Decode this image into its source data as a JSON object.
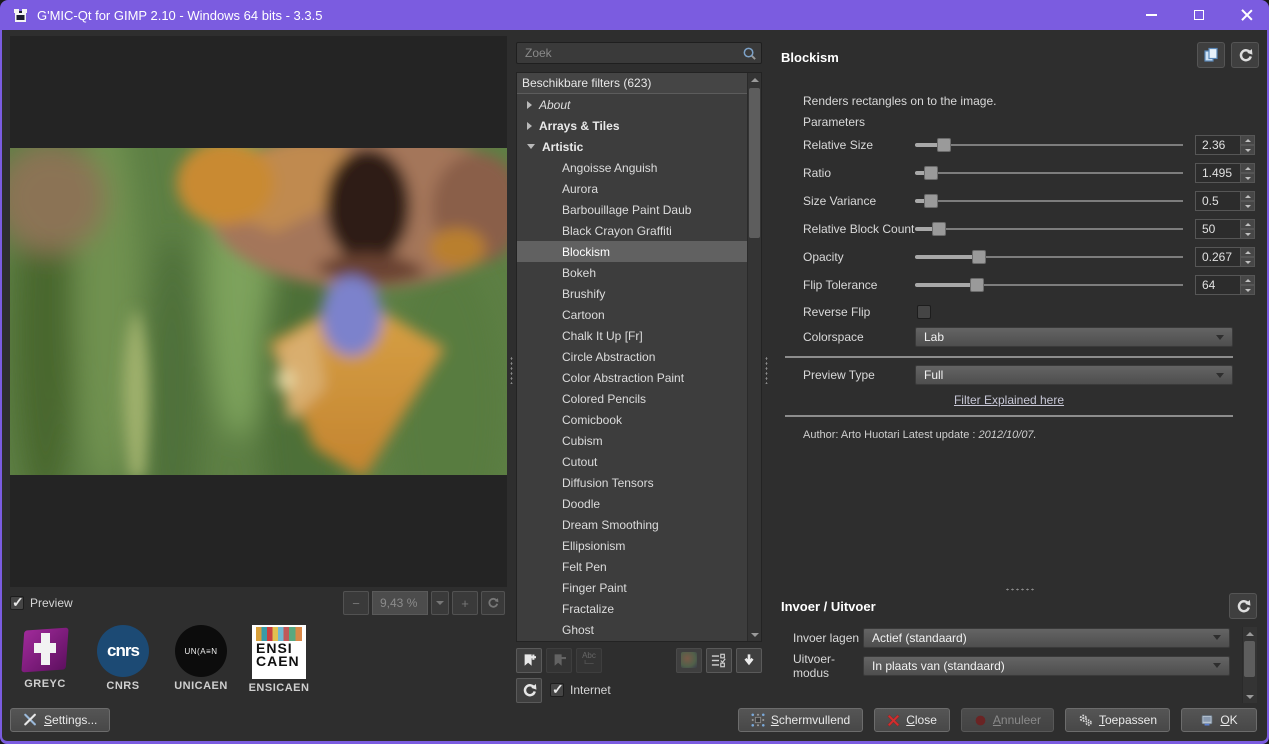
{
  "window": {
    "title": "G'MIC-Qt for GIMP 2.10 - Windows 64 bits - 3.3.5"
  },
  "preview": {
    "checkbox_label": "Preview",
    "checkbox_checked": true,
    "zoom": {
      "out": "−",
      "value": "9,43 %",
      "in": "+"
    },
    "logos": [
      {
        "label": "GREYC"
      },
      {
        "label": "CNRS",
        "badge_text": "cnrs"
      },
      {
        "label": "UNICAEN",
        "badge_text": "UN(A≡N"
      },
      {
        "label": "ENSICAEN",
        "line1": "ENSI",
        "line2": "CAEN"
      }
    ],
    "settings_label": "Settings..."
  },
  "search": {
    "placeholder": "Zoek"
  },
  "filters": {
    "header": "Beschikbare filters (623)",
    "categories": [
      {
        "label": "About",
        "expanded": false
      },
      {
        "label": "Arrays & Tiles",
        "expanded": false
      },
      {
        "label": "Artistic",
        "expanded": true
      }
    ],
    "children": [
      "Angoisse Anguish",
      "Aurora",
      "Barbouillage Paint Daub",
      "Black Crayon Graffiti",
      "Blockism",
      "Bokeh",
      "Brushify",
      "Cartoon",
      "Chalk It Up [Fr]",
      "Circle Abstraction",
      "Color Abstraction Paint",
      "Colored Pencils",
      "Comicbook",
      "Cubism",
      "Cutout",
      "Diffusion Tensors",
      "Doodle",
      "Dream Smoothing",
      "Ellipsionism",
      "Felt Pen",
      "Finger Paint",
      "Fractalize",
      "Ghost"
    ],
    "selected": "Blockism",
    "internet_label": "Internet"
  },
  "panel": {
    "title": "Blockism",
    "description": "Renders rectangles on to the image.",
    "parameters_label": "Parameters",
    "sliders": [
      {
        "label": "Relative Size",
        "value": "2.36",
        "pos": 11
      },
      {
        "label": "Ratio",
        "value": "1.495",
        "pos": 6
      },
      {
        "label": "Size Variance",
        "value": "0.5",
        "pos": 6
      },
      {
        "label": "Relative Block Count",
        "value": "50",
        "pos": 9
      },
      {
        "label": "Opacity",
        "value": "0.267",
        "pos": 24
      },
      {
        "label": "Flip Tolerance",
        "value": "64",
        "pos": 23
      }
    ],
    "reverse_flip_label": "Reverse Flip",
    "reverse_flip_checked": false,
    "colorspace_label": "Colorspace",
    "colorspace_value": "Lab",
    "preview_type_label": "Preview Type",
    "preview_type_value": "Full",
    "link_label": "Filter Explained here",
    "author_prefix": "Author: Arto Huotari Latest update : ",
    "author_date": "2012/10/07."
  },
  "io": {
    "title": "Invoer / Uitvoer",
    "input_label": "Invoer lagen",
    "input_value": "Actief (standaard)",
    "output_label": "Uitvoer-modus",
    "output_value": "In plaats van (standaard)"
  },
  "footer": {
    "buttons": [
      {
        "label": "Schermvullend",
        "disabled": false
      },
      {
        "label": "Close",
        "disabled": false
      },
      {
        "label": "Annuleer",
        "disabled": true
      },
      {
        "label": "Toepassen",
        "disabled": false
      },
      {
        "label": "OK",
        "disabled": false
      }
    ]
  },
  "icons": [
    "gmic-logo",
    "minimize",
    "maximize",
    "close",
    "magnifier",
    "collapsed-arrow",
    "expanded-arrow",
    "add-bookmark",
    "remove-bookmark",
    "rename",
    "palette",
    "layer-settings",
    "download",
    "refresh",
    "copy-settings",
    "reset",
    "fullscreen",
    "close-x",
    "cancel-dot",
    "gears",
    "ok-window",
    "wrench-settings"
  ],
  "colors": {
    "titlebar": "#7b5ce0",
    "background": "#2e2e2e",
    "selection": "#616161",
    "close_red": "#d22f2f"
  }
}
